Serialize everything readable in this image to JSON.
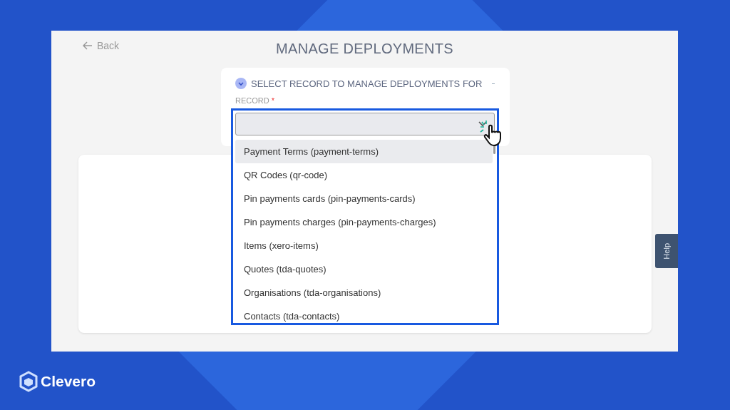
{
  "header": {
    "back": "Back",
    "title": "MANAGE DEPLOYMENTS"
  },
  "record_card": {
    "title": "SELECT RECORD TO MANAGE DEPLOYMENTS FOR",
    "expanded": true,
    "field_label": "RECORD",
    "required_mark": "*"
  },
  "dropdown_options": [
    {
      "label": "Payment Terms (payment-terms)",
      "selected": true
    },
    {
      "label": "QR Codes (qr-code)",
      "selected": false
    },
    {
      "label": "Pin payments cards (pin-payments-cards)",
      "selected": false
    },
    {
      "label": "Pin payments charges (pin-payments-charges)",
      "selected": false
    },
    {
      "label": "Items (xero-items)",
      "selected": false
    },
    {
      "label": "Quotes (tda-quotes)",
      "selected": false
    },
    {
      "label": "Organisations (tda-organisations)",
      "selected": false
    },
    {
      "label": "Contacts (tda-contacts)",
      "selected": false
    }
  ],
  "help_tab": "Help",
  "brand": "Clevero"
}
